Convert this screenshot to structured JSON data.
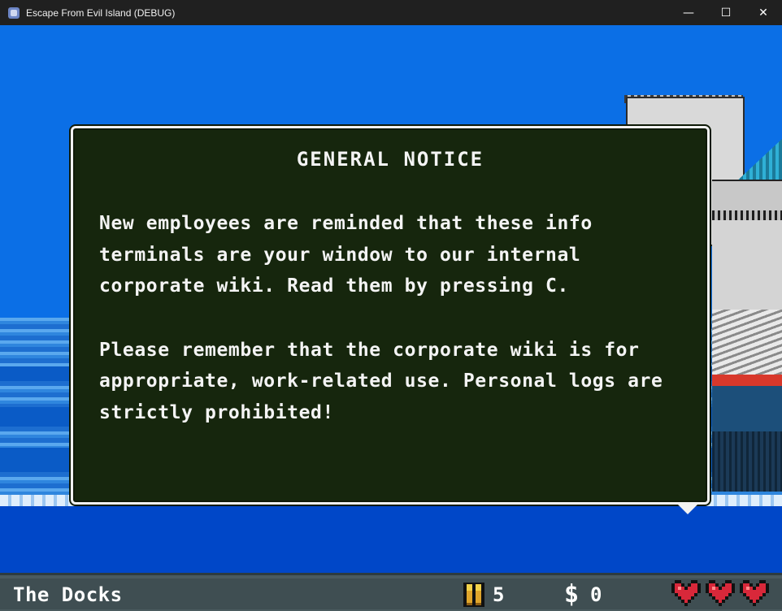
{
  "window": {
    "title": "Escape From Evil Island (DEBUG)",
    "controls": {
      "minimize": "—",
      "maximize": "☐",
      "close": "✕"
    }
  },
  "notice": {
    "title": "GENERAL NOTICE",
    "paragraph_1": "New employees are reminded that these info terminals are your window to our internal corporate wiki. Read them by pressing C.",
    "paragraph_2": "Please remember that the corporate wiki is for appropriate, work-related use. Personal logs are strictly prohibited!"
  },
  "hud": {
    "location": "The Docks",
    "ammo_icon": "bullets-icon",
    "ammo": "5",
    "money_icon": "$",
    "money": "0",
    "hearts": 3,
    "heart_color": "#d8283a"
  },
  "colors": {
    "sky": "#0b6fe6",
    "dialog_bg": "#16260d",
    "dialog_border": "#f2f2f2",
    "hud_bg": "#3f4e52"
  }
}
